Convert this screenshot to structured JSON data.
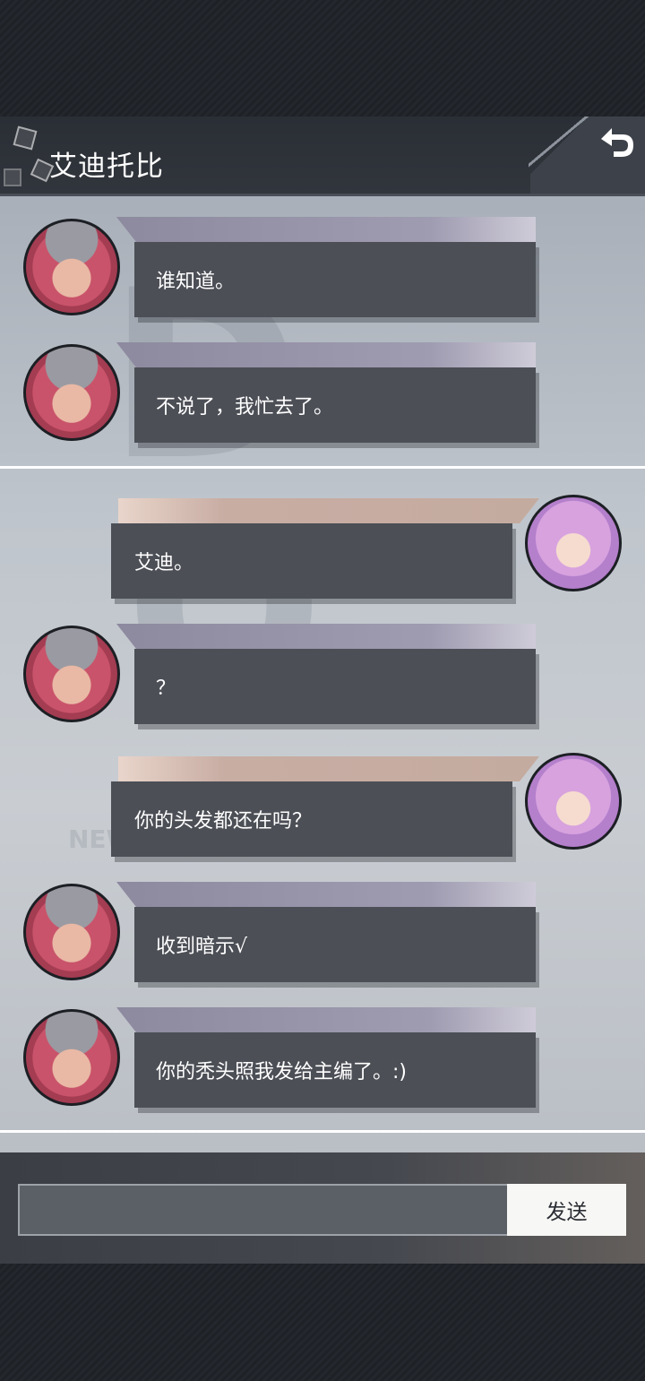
{
  "header": {
    "title": "艾迪托比"
  },
  "messages": [
    {
      "side": "left",
      "speaker": "andy",
      "text": "谁知道。"
    },
    {
      "side": "left",
      "speaker": "andy",
      "text": "不说了，我忙去了。"
    },
    {
      "side": "right",
      "speaker": "girl",
      "text": "艾迪。"
    },
    {
      "side": "left",
      "speaker": "andy",
      "text": "？"
    },
    {
      "side": "right",
      "speaker": "girl",
      "text": "你的头发都还在吗？"
    },
    {
      "side": "left",
      "speaker": "andy",
      "text": "收到暗示√"
    },
    {
      "side": "left",
      "speaker": "andy",
      "text": "你的秃头照我发给主编了。:)"
    }
  ],
  "background": {
    "watermark": "NEWTASK"
  },
  "input": {
    "value": "",
    "send_label": "发送"
  }
}
